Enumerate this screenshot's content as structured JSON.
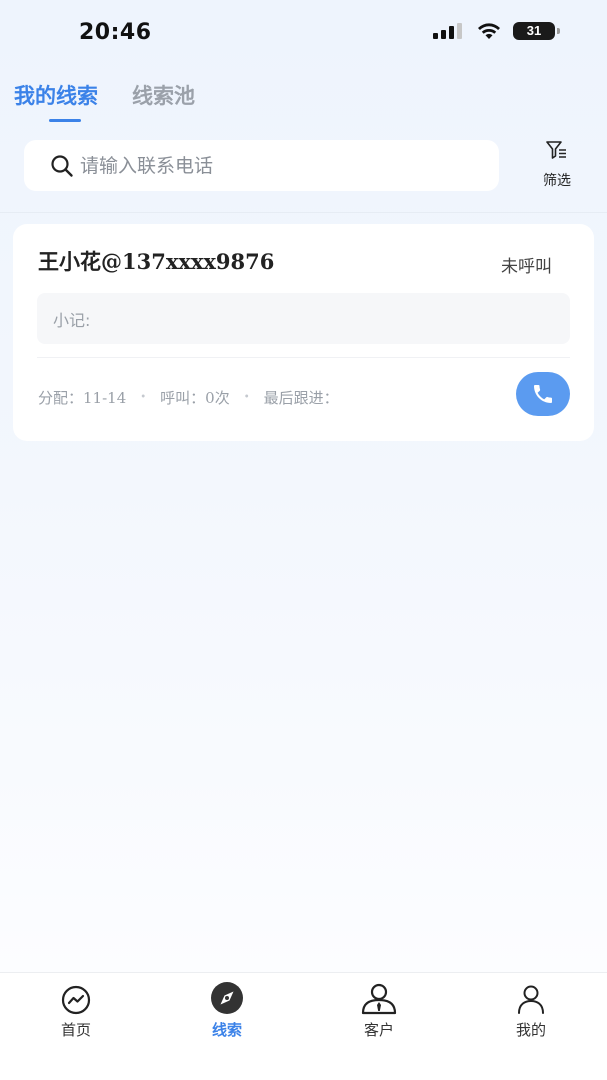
{
  "status_bar": {
    "time": "20:46",
    "battery": "31"
  },
  "tabs": [
    {
      "label": "我的线索",
      "active": true
    },
    {
      "label": "线索池",
      "active": false
    }
  ],
  "search": {
    "placeholder": "请输入联系电话"
  },
  "filter": {
    "label": "筛选"
  },
  "leads": [
    {
      "title": "王小花@137xxxx9876",
      "status": "未呼叫",
      "note_label": "小记:",
      "assigned": "分配：11-14",
      "calls": "呼叫：0次",
      "last_follow": "最后跟进："
    }
  ],
  "bottom_nav": [
    {
      "label": "首页",
      "icon": "trend-chart-icon"
    },
    {
      "label": "线索",
      "icon": "compass-icon"
    },
    {
      "label": "客户",
      "icon": "customer-icon"
    },
    {
      "label": "我的",
      "icon": "person-icon"
    }
  ],
  "colors": {
    "accent": "#3b82e8",
    "call_button": "#5b9bf0",
    "inactive_tab": "#9ba1aa"
  }
}
